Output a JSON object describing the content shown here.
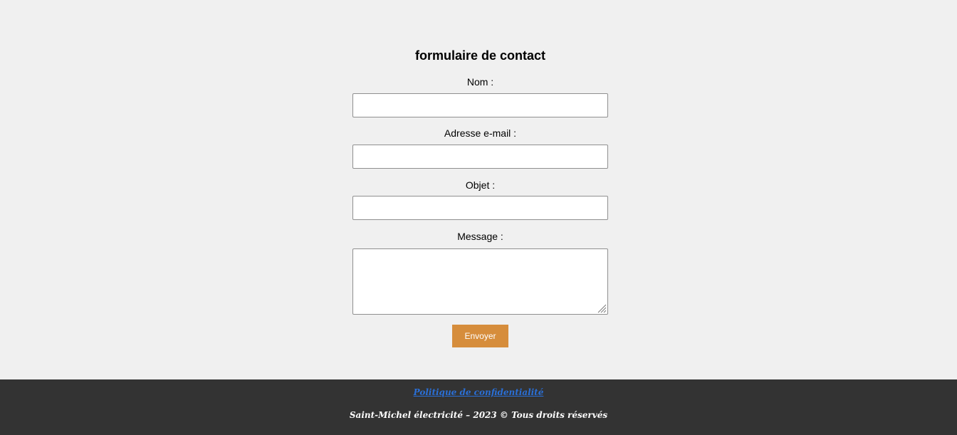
{
  "form": {
    "title": "formulaire de contact",
    "fields": [
      {
        "label": "Nom :",
        "value": ""
      },
      {
        "label": "Adresse e-mail :",
        "value": ""
      },
      {
        "label": "Objet :",
        "value": ""
      },
      {
        "label": "Message :",
        "value": ""
      }
    ],
    "submit_label": "Envoyer"
  },
  "footer": {
    "privacy_link": "Politique de confidentialité",
    "copyright": "Saint-Michel électricité – 2023 © Tous droits réservés"
  },
  "colors": {
    "background": "#f0f0f0",
    "submit_button": "#d68d3c",
    "footer_background": "#333333",
    "link": "#2a6fd6"
  },
  "icons": {
    "resize_handle": "resize-grip-icon"
  }
}
